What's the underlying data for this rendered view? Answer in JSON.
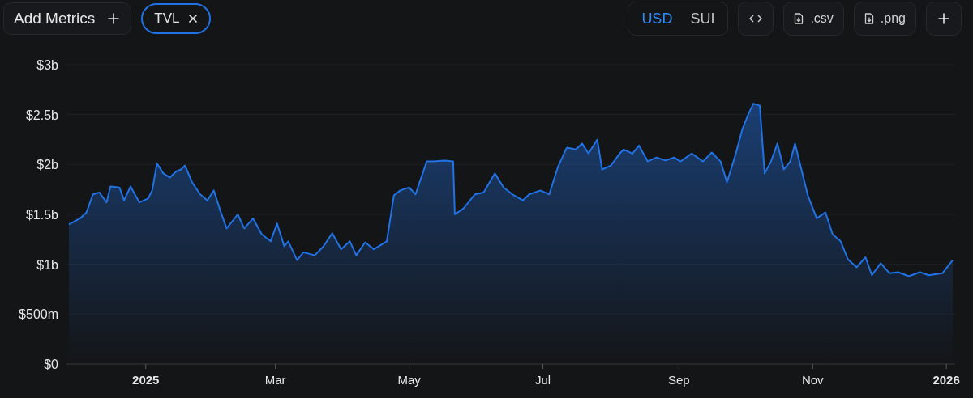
{
  "toolbar": {
    "add_metrics": {
      "label": "Add Metrics"
    },
    "metric_chips": [
      {
        "label": "TVL"
      }
    ],
    "currency": [
      {
        "label": "USD",
        "selected": true
      },
      {
        "label": "SUI",
        "selected": false
      }
    ],
    "actions": [
      {
        "kind": "embed"
      },
      {
        "kind": "csv",
        "label": ".csv"
      },
      {
        "kind": "png",
        "label": ".png"
      },
      {
        "kind": "add"
      }
    ]
  },
  "chart": {
    "chart_data": {
      "type": "area",
      "grid": true,
      "xlim": [
        2024.901,
        2026.011
      ],
      "ylim": [
        0,
        3000000000
      ],
      "xticks": [
        {
          "value": 2025,
          "label": "2025"
        },
        {
          "value": 2025.162,
          "label": "Mar"
        },
        {
          "value": 2025.329,
          "label": "May"
        },
        {
          "value": 2025.496,
          "label": "Jul"
        },
        {
          "value": 2025.666,
          "label": "Sep"
        },
        {
          "value": 2025.833,
          "label": "Nov"
        },
        {
          "value": 2026,
          "label": "2026"
        }
      ],
      "yticks": [
        {
          "value": 0,
          "label": "$0"
        },
        {
          "value": 500000000,
          "label": "$500m"
        },
        {
          "value": 1000000000,
          "label": "$1b"
        },
        {
          "value": 1500000000,
          "label": "$1.5b"
        },
        {
          "value": 2000000000,
          "label": "$2b"
        },
        {
          "value": 2500000000,
          "label": "$2.5b"
        },
        {
          "value": 3000000000,
          "label": "$3b"
        }
      ],
      "x": [
        2024.904,
        2024.918,
        2024.926,
        2024.934,
        2024.942,
        2024.951,
        2024.956,
        2024.967,
        2024.973,
        2024.981,
        2024.992,
        2025.003,
        2025.008,
        2025.014,
        2025.022,
        2025.03,
        2025.038,
        2025.044,
        2025.049,
        2025.058,
        2025.068,
        2025.077,
        2025.085,
        2025.093,
        2025.101,
        2025.115,
        2025.123,
        2025.134,
        2025.145,
        2025.156,
        2025.164,
        2025.173,
        2025.178,
        2025.189,
        2025.197,
        2025.211,
        2025.222,
        2025.233,
        2025.244,
        2025.255,
        2025.263,
        2025.274,
        2025.285,
        2025.301,
        2025.31,
        2025.318,
        2025.329,
        2025.337,
        2025.351,
        2025.359,
        2025.373,
        2025.384,
        2025.386,
        2025.397,
        2025.411,
        2025.422,
        2025.436,
        2025.447,
        2025.458,
        2025.471,
        2025.479,
        2025.493,
        2025.504,
        2025.515,
        2025.526,
        2025.537,
        2025.545,
        2025.553,
        2025.564,
        2025.57,
        2025.581,
        2025.592,
        2025.597,
        2025.608,
        2025.616,
        2025.627,
        2025.638,
        2025.649,
        2025.66,
        2025.668,
        2025.682,
        2025.696,
        2025.707,
        2025.718,
        2025.726,
        2025.737,
        2025.745,
        2025.753,
        2025.759,
        2025.767,
        2025.773,
        2025.781,
        2025.789,
        2025.797,
        2025.805,
        2025.811,
        2025.822,
        2025.827,
        2025.838,
        2025.849,
        2025.858,
        2025.868,
        2025.877,
        2025.888,
        2025.899,
        2025.907,
        2025.918,
        2025.929,
        2025.94,
        2025.953,
        2025.967,
        2025.978,
        2025.995,
        2026.008
      ],
      "series": [
        {
          "color": "#2172e5",
          "values": [
            1400000000.0,
            1460000000.0,
            1520000000.0,
            1700000000.0,
            1720000000.0,
            1620000000.0,
            1780000000.0,
            1770000000.0,
            1640000000.0,
            1780000000.0,
            1620000000.0,
            1660000000.0,
            1740000000.0,
            2010000000.0,
            1910000000.0,
            1870000000.0,
            1930000000.0,
            1950000000.0,
            1990000000.0,
            1820000000.0,
            1700000000.0,
            1640000000.0,
            1740000000.0,
            1540000000.0,
            1360000000.0,
            1500000000.0,
            1360000000.0,
            1460000000.0,
            1300000000.0,
            1230000000.0,
            1410000000.0,
            1180000000.0,
            1230000000.0,
            1040000000.0,
            1120000000.0,
            1090000000.0,
            1180000000.0,
            1310000000.0,
            1150000000.0,
            1230000000.0,
            1090000000.0,
            1220000000.0,
            1150000000.0,
            1230000000.0,
            1690000000.0,
            1740000000.0,
            1770000000.0,
            1700000000.0,
            2030000000.0,
            2030000000.0,
            2040000000.0,
            2030000000.0,
            1500000000.0,
            1560000000.0,
            1700000000.0,
            1720000000.0,
            1910000000.0,
            1770000000.0,
            1700000000.0,
            1640000000.0,
            1700000000.0,
            1740000000.0,
            1700000000.0,
            1980000000.0,
            2170000000.0,
            2150000000.0,
            2210000000.0,
            2110000000.0,
            2250000000.0,
            1950000000.0,
            1990000000.0,
            2110000000.0,
            2150000000.0,
            2110000000.0,
            2190000000.0,
            2030000000.0,
            2070000000.0,
            2040000000.0,
            2070000000.0,
            2030000000.0,
            2110000000.0,
            2030000000.0,
            2120000000.0,
            2030000000.0,
            1820000000.0,
            2110000000.0,
            2350000000.0,
            2510000000.0,
            2610000000.0,
            2590000000.0,
            1910000000.0,
            2030000000.0,
            2210000000.0,
            1950000000.0,
            2030000000.0,
            2210000000.0,
            1850000000.0,
            1690000000.0,
            1460000000.0,
            1520000000.0,
            1300000000.0,
            1230000000.0,
            1050000000.0,
            970000000.0,
            1070000000.0,
            890000000.0,
            1010000000.0,
            910000000.0,
            920000000.0,
            880000000.0,
            920000000.0,
            890000000.0,
            910000000.0,
            1040000000.0
          ]
        }
      ]
    }
  }
}
